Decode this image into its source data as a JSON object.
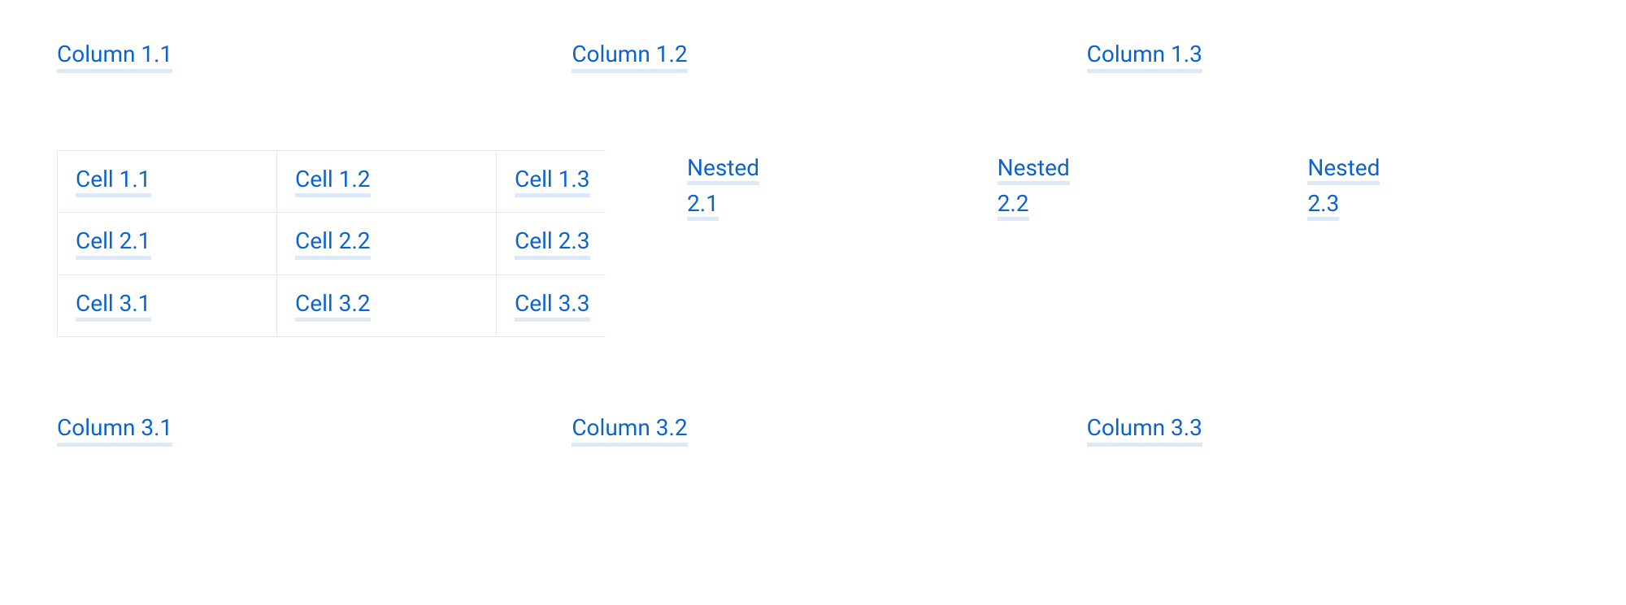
{
  "columns": {
    "row1": [
      "Column 1.1",
      "Column 1.2",
      "Column 1.3"
    ],
    "row3": [
      "Column 3.1",
      "Column 3.2",
      "Column 3.3"
    ]
  },
  "inner_table": [
    [
      "Cell 1.1",
      "Cell 1.2",
      "Cell 1.3"
    ],
    [
      "Cell 2.1",
      "Cell 2.2",
      "Cell 2.3"
    ],
    [
      "Cell 3.1",
      "Cell 3.2",
      "Cell 3.3"
    ]
  ],
  "nested": [
    "Nested 2.1",
    "Nested 2.2",
    "Nested 2.3"
  ]
}
